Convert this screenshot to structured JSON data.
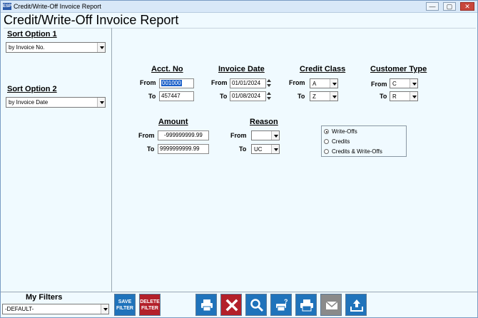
{
  "window": {
    "title": "Credit/Write-Off Invoice Report",
    "icon_text": "ESP",
    "minimize": "—",
    "restore": "▢",
    "close": "✕"
  },
  "report_title": "Credit/Write-Off Invoice Report",
  "sort_option_1": {
    "label": "Sort Option 1",
    "value": "by Invoice No."
  },
  "sort_option_2": {
    "label": "Sort Option 2",
    "value": "by Invoice Date"
  },
  "acct_no": {
    "label": "Acct. No",
    "from_label": "From",
    "to_label": "To",
    "from": "001000",
    "to": "457447"
  },
  "invoice_date": {
    "label": "Invoice Date",
    "from_label": "From",
    "to_label": "To",
    "from": "01/01/2024",
    "to": "01/08/2024"
  },
  "credit_class": {
    "label": "Credit Class",
    "from_label": "From",
    "to_label": "To",
    "from": "A",
    "to": "Z"
  },
  "customer_type": {
    "label": "Customer Type",
    "from_label": "From",
    "to_label": "To",
    "from": "C",
    "to": "R"
  },
  "amount": {
    "label": "Amount",
    "from_label": "From",
    "to_label": "To",
    "from": "-999999999.99",
    "to": "9999999999.99"
  },
  "reason": {
    "label": "Reason",
    "from_label": "From",
    "to_label": "To",
    "from": "",
    "to": "UC"
  },
  "type_options": [
    {
      "label": "Write-Offs",
      "selected": true
    },
    {
      "label": "Credits",
      "selected": false
    },
    {
      "label": "Credits & Write-Offs",
      "selected": false
    }
  ],
  "my_filters": {
    "label": "My Filters",
    "value": "-DEFAULT-"
  },
  "toolbar": {
    "save_filter": "SAVE FILTER",
    "delete_filter": "DELETE FILTER",
    "icons": [
      "print-icon",
      "cancel-icon",
      "search-icon",
      "print-help-icon",
      "print-preview-icon",
      "email-icon",
      "export-icon"
    ]
  },
  "colors": {
    "background": "#f0faff",
    "accent_blue": "#1f73bb",
    "accent_red": "#b3202a",
    "selection": "#1a5fc8"
  }
}
